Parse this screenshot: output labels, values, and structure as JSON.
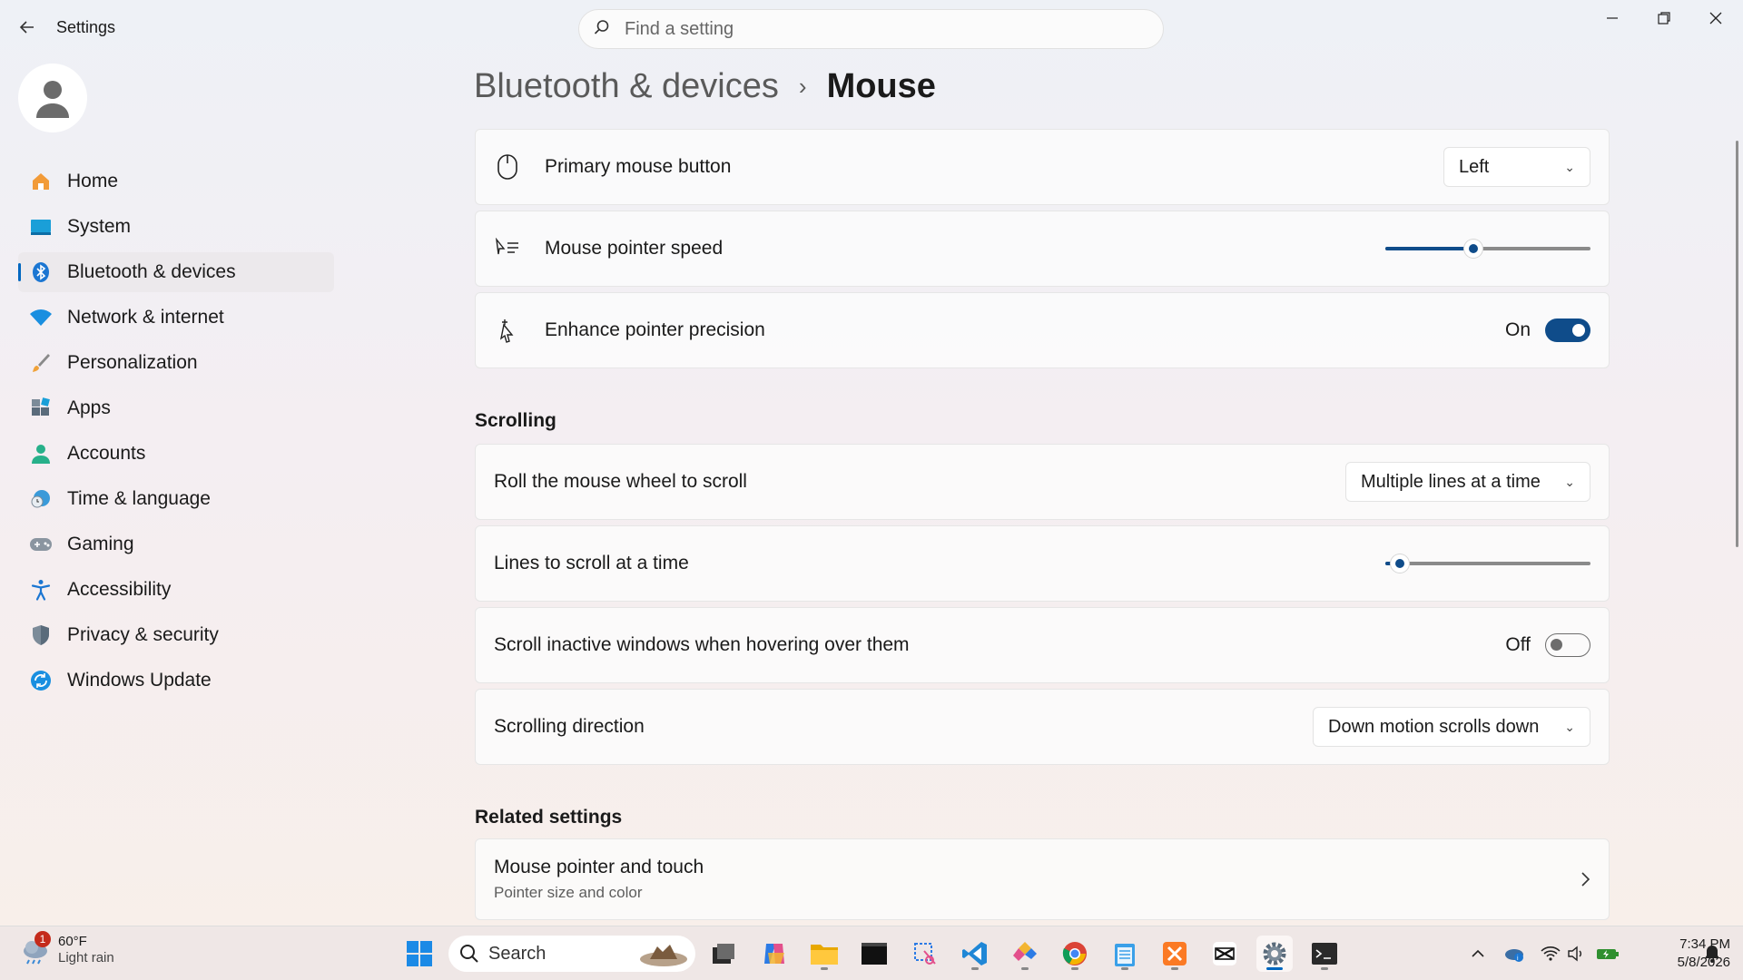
{
  "app": {
    "title": "Settings"
  },
  "search": {
    "placeholder": "Find a setting"
  },
  "sidebar": {
    "items": [
      {
        "label": "Home",
        "icon": "home-icon"
      },
      {
        "label": "System",
        "icon": "system-icon"
      },
      {
        "label": "Bluetooth & devices",
        "icon": "bluetooth-icon",
        "active": true
      },
      {
        "label": "Network & internet",
        "icon": "wifi-icon"
      },
      {
        "label": "Personalization",
        "icon": "brush-icon"
      },
      {
        "label": "Apps",
        "icon": "apps-icon"
      },
      {
        "label": "Accounts",
        "icon": "accounts-icon"
      },
      {
        "label": "Time & language",
        "icon": "clock-globe-icon"
      },
      {
        "label": "Gaming",
        "icon": "gamepad-icon"
      },
      {
        "label": "Accessibility",
        "icon": "accessibility-icon"
      },
      {
        "label": "Privacy & security",
        "icon": "shield-icon"
      },
      {
        "label": "Windows Update",
        "icon": "update-icon"
      }
    ]
  },
  "breadcrumb": {
    "parent": "Bluetooth & devices",
    "separator": "›",
    "current": "Mouse"
  },
  "mouse": {
    "primary_button": {
      "label": "Primary mouse button",
      "value": "Left"
    },
    "pointer_speed": {
      "label": "Mouse pointer speed",
      "level": 0.43
    },
    "enhance_precision": {
      "label": "Enhance pointer precision",
      "state": "On"
    }
  },
  "scrolling": {
    "title": "Scrolling",
    "roll_wheel": {
      "label": "Roll the mouse wheel to scroll",
      "value": "Multiple lines at a time"
    },
    "lines": {
      "label": "Lines to scroll at a time",
      "level": 0.07
    },
    "inactive": {
      "label": "Scroll inactive windows when hovering over them",
      "state": "Off"
    },
    "direction": {
      "label": "Scrolling direction",
      "value": "Down motion scrolls down"
    }
  },
  "related": {
    "title": "Related settings",
    "pointer_touch": {
      "label": "Mouse pointer and touch",
      "sub": "Pointer size and color"
    }
  },
  "taskbar": {
    "weather": {
      "temp": "60°F",
      "condition": "Light rain",
      "badge": "1"
    },
    "search_label": "Search",
    "clock": {
      "time": "7:34 PM",
      "date": "5/8/2026"
    }
  },
  "colors": {
    "accent": "#0f4c8a",
    "active_indicator": "#0067c0"
  }
}
